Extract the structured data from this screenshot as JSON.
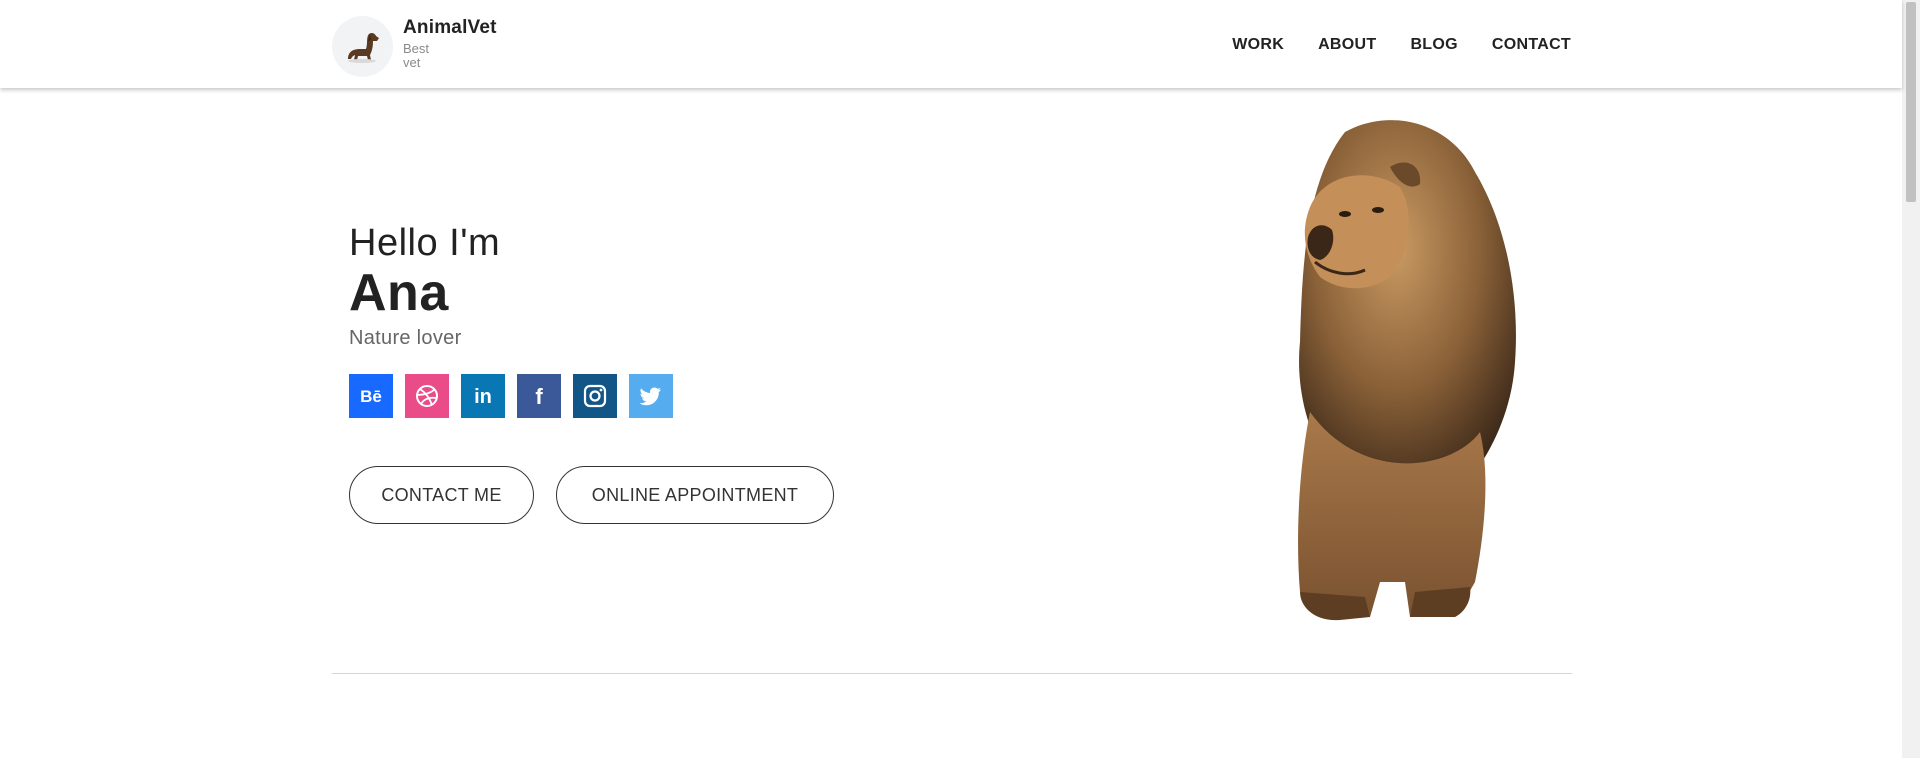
{
  "header": {
    "brand_name": "AnimalVet",
    "brand_tagline": "Best vet",
    "logo_icon": "dog-icon",
    "nav": [
      {
        "label": "WORK"
      },
      {
        "label": "ABOUT"
      },
      {
        "label": "BLOG"
      },
      {
        "label": "CONTACT"
      }
    ]
  },
  "hero": {
    "greeting": "Hello I'm",
    "name": "Ana",
    "tagline": "Nature lover",
    "socials": [
      {
        "icon": "behance-icon",
        "glyph": "Bē",
        "color": "#1769ff"
      },
      {
        "icon": "dribbble-icon",
        "color": "#ea4c89"
      },
      {
        "icon": "linkedin-icon",
        "glyph": "in",
        "color": "#0a77b5"
      },
      {
        "icon": "facebook-icon",
        "glyph": "f",
        "color": "#3b5998"
      },
      {
        "icon": "instagram-icon",
        "color": "#125688"
      },
      {
        "icon": "twitter-icon",
        "color": "#55acee"
      }
    ],
    "buttons": {
      "contact": "CONTACT ME",
      "appointment": "ONLINE APPOINTMENT"
    },
    "image_icon": "lion-image"
  }
}
